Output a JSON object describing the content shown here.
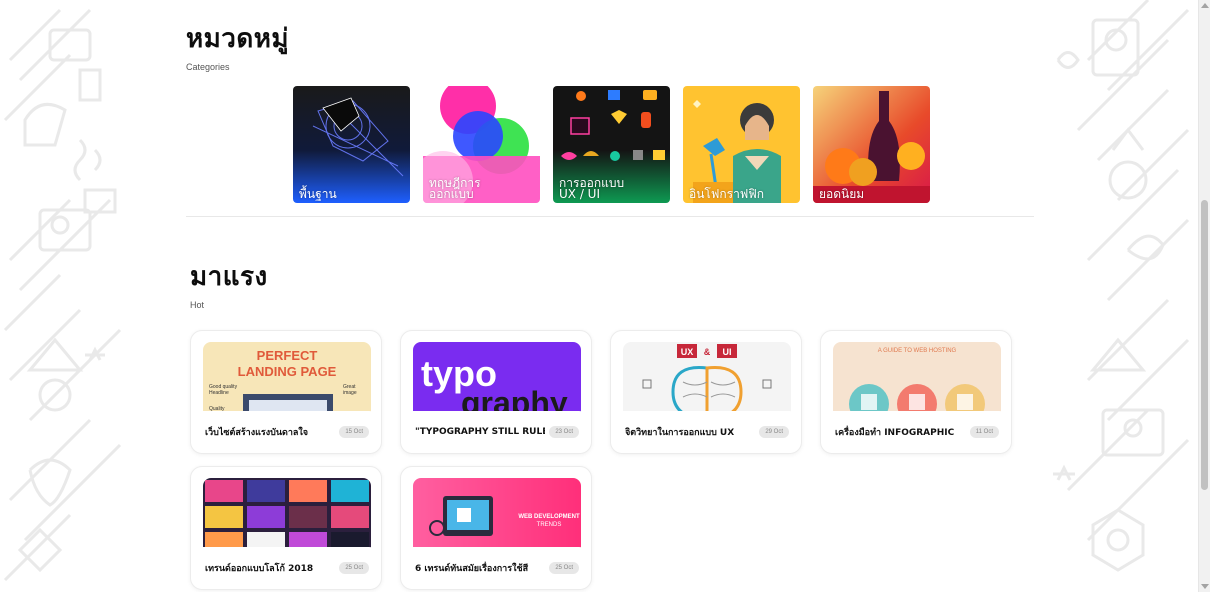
{
  "categories_section": {
    "title": "หมวดหมู่",
    "subtitle": "Categories",
    "items": [
      {
        "label": "พื้นฐาน"
      },
      {
        "label": "ทฤษฎีการ\nออกแบบ"
      },
      {
        "label": "การออกแบบ\nUX / UI"
      },
      {
        "label": "อินโฟกราฟฟิก"
      },
      {
        "label": "ยอดนิยม"
      }
    ]
  },
  "hot_section": {
    "title": "มาแรง",
    "subtitle": "Hot",
    "posts": [
      {
        "title": "เว็บไซต์สร้างแรงบันดาลใจ",
        "date": "15 Oct",
        "thumb_text": [
          "PERFECT",
          "LANDING PAGE",
          "Good quality",
          "Headline",
          "Great",
          "image",
          "Quality"
        ]
      },
      {
        "title": "\"TYPOGRAPHY STILL RULES\"",
        "date": "23 Oct",
        "thumb_text": [
          "typo",
          "graphy"
        ]
      },
      {
        "title": "จิตวิทยาในการออกแบบ UX",
        "date": "29 Oct",
        "thumb_text": [
          "UX",
          "&",
          "UI"
        ]
      },
      {
        "title": "เครื่องมือทำ INFOGRAPHIC",
        "date": "11 Oct",
        "thumb_text": [
          "A GUIDE TO WEB HOSTING"
        ]
      },
      {
        "title": "เทรนด์ออกแบบโลโก้ 2018",
        "date": "25 Oct",
        "thumb_text": []
      },
      {
        "title": "6 เทรนด์ทันสมัยเรื่องการใช้สี",
        "date": "25 Oct",
        "thumb_text": [
          "WEB DEVELOPMENT",
          "TRENDS"
        ]
      }
    ]
  },
  "colors": {
    "basics_bg": "#1a1a1a",
    "basics_accent": "#1e5fff",
    "theory_bg": "#ff3fb0",
    "uxui_bg": "#111111",
    "infographic_bg": "#ffc330",
    "popular_bg": "#e84a2a",
    "typography_bg": "#7a2cf0",
    "webdev_bg": "#ff3c8f"
  }
}
